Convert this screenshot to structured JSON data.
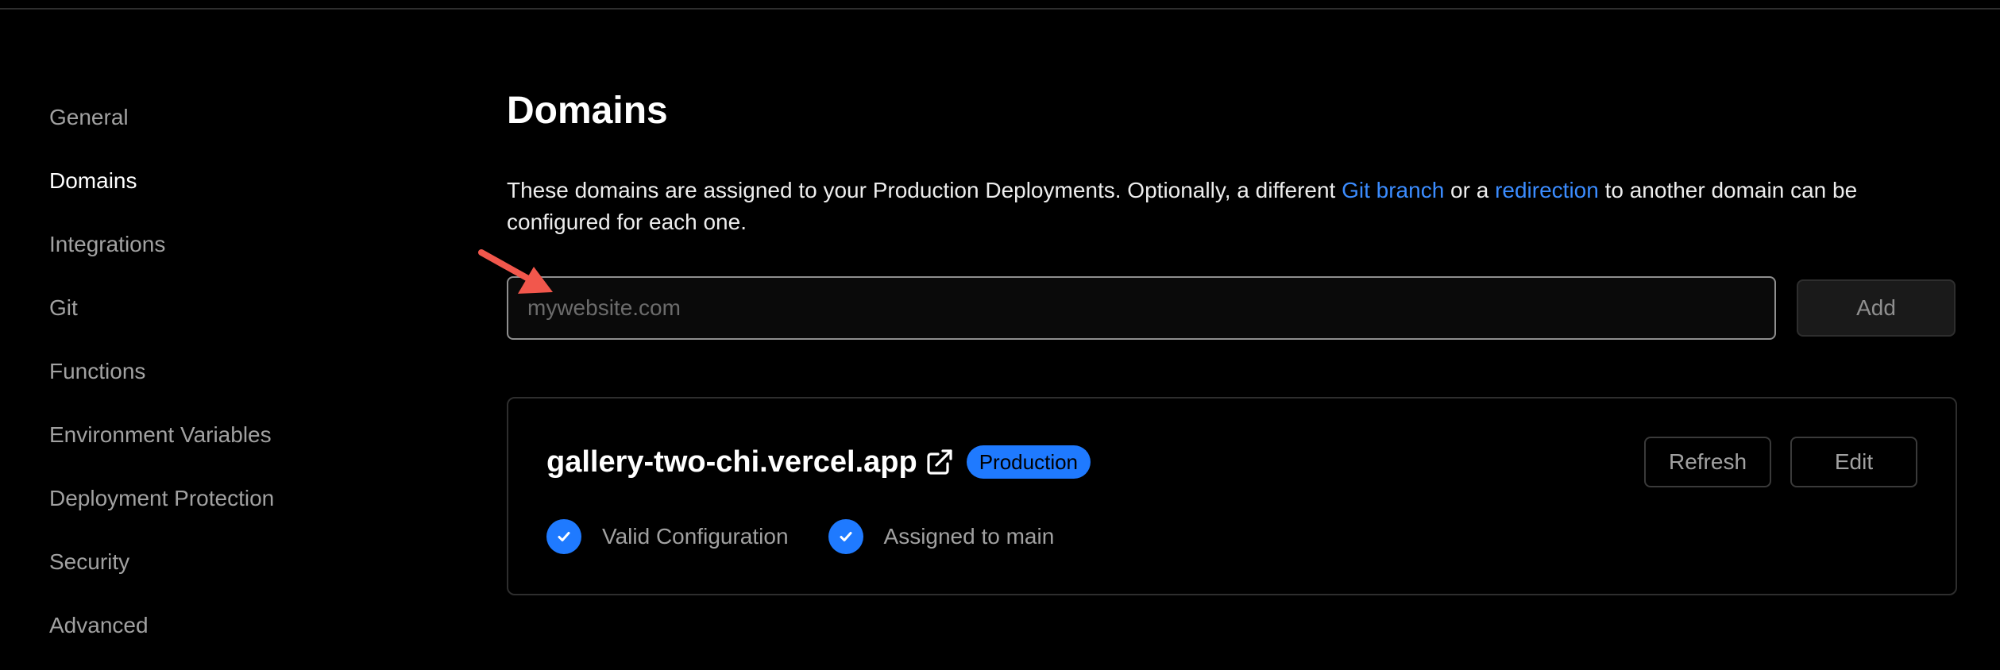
{
  "sidebar": {
    "items": [
      {
        "label": "General"
      },
      {
        "label": "Domains",
        "active": true
      },
      {
        "label": "Integrations"
      },
      {
        "label": "Git"
      },
      {
        "label": "Functions"
      },
      {
        "label": "Environment Variables"
      },
      {
        "label": "Deployment Protection"
      },
      {
        "label": "Security"
      },
      {
        "label": "Advanced"
      }
    ]
  },
  "main": {
    "title": "Domains",
    "description": {
      "part1": "These domains are assigned to your Production Deployments. Optionally, a different ",
      "link1": "Git branch",
      "part2": " or a ",
      "link2": "redirection",
      "part3": " to another domain can be configured for each one."
    },
    "add_domain": {
      "placeholder": "mywebsite.com",
      "value": "",
      "button_label": "Add"
    }
  },
  "domain_card": {
    "domain": "gallery-two-chi.vercel.app",
    "external_icon": "external-link-icon",
    "badge": "Production",
    "refresh_label": "Refresh",
    "edit_label": "Edit",
    "statuses": [
      {
        "label": "Valid Configuration",
        "icon": "check-circle-icon"
      },
      {
        "label": "Assigned to main",
        "icon": "check-circle-icon"
      }
    ]
  },
  "colors": {
    "background": "#000000",
    "accent": "#1f7aff",
    "link": "#3b8cff",
    "annotation_arrow": "#f2574c"
  }
}
